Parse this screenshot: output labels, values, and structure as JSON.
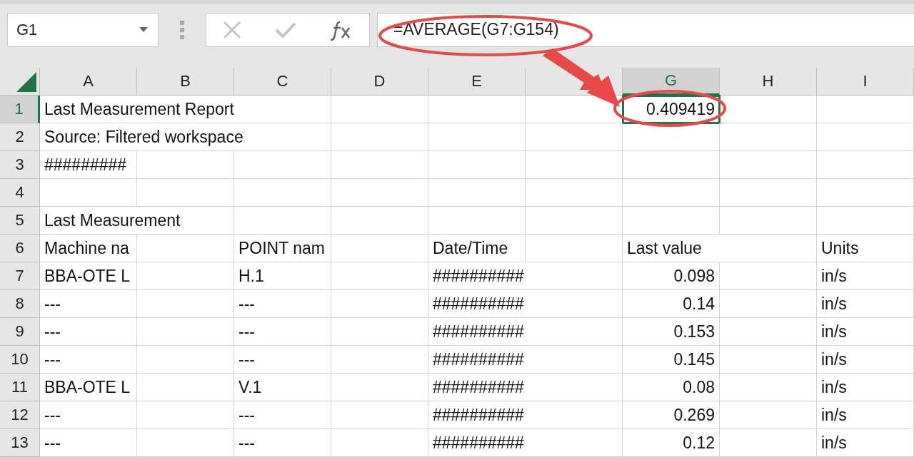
{
  "name_box": {
    "value": "G1"
  },
  "formula_bar": {
    "value": "=AVERAGE(G7:G154)"
  },
  "columns": [
    {
      "label": "A",
      "selected": false
    },
    {
      "label": "B",
      "selected": false
    },
    {
      "label": "C",
      "selected": false
    },
    {
      "label": "D",
      "selected": false
    },
    {
      "label": "E",
      "selected": false
    },
    {
      "selected": false
    },
    {
      "label": "G",
      "selected": true
    },
    {
      "label": "H",
      "selected": false
    },
    {
      "label": "I",
      "selected": false
    }
  ],
  "rows": [
    {
      "number": "1",
      "selected": true,
      "cells": [
        "Last Measurement Report",
        null,
        null,
        null,
        null,
        null,
        {
          "text": "0.409419",
          "numeric": true
        },
        null,
        null
      ]
    },
    {
      "number": "2",
      "selected": false,
      "cells": [
        "Source: Filtered workspace",
        null,
        null,
        null,
        null,
        null,
        null,
        null,
        null
      ]
    },
    {
      "number": "3",
      "selected": false,
      "cells": [
        "#########",
        null,
        null,
        null,
        null,
        null,
        null,
        null,
        null
      ]
    },
    {
      "number": "4",
      "selected": false,
      "cells": [
        null,
        null,
        null,
        null,
        null,
        null,
        null,
        null,
        null
      ]
    },
    {
      "number": "5",
      "selected": false,
      "cells": [
        "Last Measurement",
        null,
        null,
        null,
        null,
        null,
        null,
        null,
        null
      ]
    },
    {
      "number": "6",
      "selected": false,
      "cells": [
        "Machine na",
        "",
        "POINT nam",
        "",
        "Date/Time",
        null,
        "Last value",
        null,
        "Units"
      ]
    },
    {
      "number": "7",
      "selected": false,
      "cells": [
        "BBA-OTE L",
        "",
        "H.1",
        null,
        "##########",
        null,
        {
          "text": "0.098",
          "numeric": true
        },
        null,
        "in/s"
      ]
    },
    {
      "number": "8",
      "selected": false,
      "cells": [
        "---",
        null,
        "---",
        null,
        "##########",
        null,
        {
          "text": "0.14",
          "numeric": true
        },
        null,
        "in/s"
      ]
    },
    {
      "number": "9",
      "selected": false,
      "cells": [
        "---",
        null,
        "---",
        null,
        "##########",
        null,
        {
          "text": "0.153",
          "numeric": true
        },
        null,
        "in/s"
      ]
    },
    {
      "number": "10",
      "selected": false,
      "cells": [
        "---",
        null,
        "---",
        null,
        "##########",
        null,
        {
          "text": "0.145",
          "numeric": true
        },
        null,
        "in/s"
      ]
    },
    {
      "number": "11",
      "selected": false,
      "cells": [
        "BBA-OTE L",
        "",
        "V.1",
        null,
        "##########",
        null,
        {
          "text": "0.08",
          "numeric": true
        },
        null,
        "in/s"
      ]
    },
    {
      "number": "12",
      "selected": false,
      "cells": [
        "---",
        null,
        "---",
        null,
        "##########",
        null,
        {
          "text": "0.269",
          "numeric": true
        },
        null,
        "in/s"
      ]
    },
    {
      "number": "13",
      "selected": false,
      "cells": [
        "---",
        null,
        "---",
        null,
        "##########",
        null,
        {
          "text": "0.12",
          "numeric": true
        },
        null,
        "in/s"
      ]
    }
  ]
}
